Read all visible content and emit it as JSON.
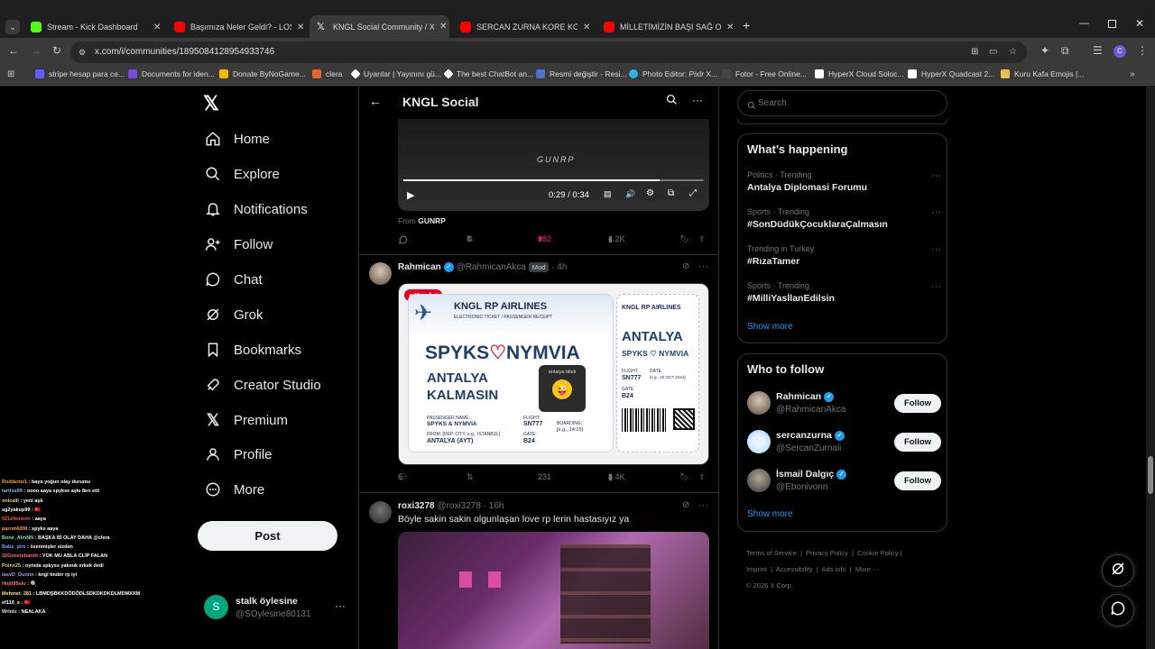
{
  "browser": {
    "tabs": [
      {
        "title": "Stream - Kick Dashboard",
        "color": "#53fc18"
      },
      {
        "title": "Başımıza Neler Geldi? - LOS AN",
        "color": "#ff0000"
      },
      {
        "title": "KNGL Social Community / X",
        "color": "#ffffff"
      },
      {
        "title": "SERCAN ZURNA KORE KOMİK A",
        "color": "#ff0000"
      },
      {
        "title": "MİLLETİMİZİN BAŞI SAĞ OLSUN",
        "color": "#ff0000"
      }
    ],
    "url": "x.com/i/communities/1895084128954933746",
    "bookmarks": [
      "stripe hesap para ce...",
      "Documents for iden...",
      "Donate ByNoGame...",
      "clera",
      "Uyarılar | Yayınını gü...",
      "The best ChatBot an...",
      "Resmi değiştir - Resi...",
      "Photo Editor: Pixlr X...",
      "Fotor - Free Online...",
      "HyperX Cloud Soloc...",
      "HyperX Quadcast 2...",
      "Kuru Kafa Emojis |..."
    ]
  },
  "nav": {
    "items": [
      "Home",
      "Explore",
      "Notifications",
      "Follow",
      "Chat",
      "Grok",
      "Bookmarks",
      "Creator Studio",
      "Premium",
      "Profile",
      "More"
    ],
    "post_label": "Post",
    "account": {
      "name": "stalk öylesine",
      "handle": "@SOylesine80131",
      "initial": "S"
    }
  },
  "header": {
    "title": "KNGL Social"
  },
  "video": {
    "time": "0:29 / 0:34",
    "brand": "GUNRP",
    "from_label": "From",
    "from_name": "GUNRP",
    "progress": 0.853
  },
  "post1_actions": {
    "replies": "",
    "reposts": "8",
    "likes": "282",
    "views": "4.2K"
  },
  "post2": {
    "name": "Rahmican",
    "handle": "@RahmicanAkca",
    "badge": "Mod",
    "time": "4h",
    "save_label": "Kaydet",
    "replies": "6",
    "reposts": "",
    "likes": "231",
    "views": "8.4K",
    "ticket": {
      "airline": "KNGL RP AIRLINES",
      "subtitle": "ELECTRONIC TICKET / PASSENGER RECEIPT",
      "name_left": "SPYKS",
      "name_right": "NYMVIA",
      "line1": "ANTALYA",
      "line2": "KALMASIN",
      "sticker": "antalya bileti",
      "passenger_label": "PASSENGER NAME:",
      "passenger": "SPYKS & NYMVIA",
      "from_label": "FROM: [DEP. CITY, e.g., ISTANBUL]",
      "from": "ANTALYA (AYT)",
      "flight_label": "FLIGHT:",
      "flight": "SN777",
      "gate_label": "GATE:",
      "gate": "B24",
      "boarding_label": "BOARDING:",
      "boarding": "[e.g., 14:15]",
      "stub_airline": "KNGL RP AIRLINES",
      "stub_dest": "ANTALYA",
      "stub_names": "SPYKS ♡ NYMVIA",
      "stub_flight_label": "FLIGHT",
      "stub_flight": "SN777",
      "stub_date_label": "DATE",
      "stub_date": "[e.g., 20 OCT 2024]",
      "stub_gate_label": "GATE",
      "stub_gate": "B24"
    }
  },
  "post3": {
    "name": "roxi3278",
    "handle": "@roxi3278",
    "time": "16h",
    "text": "Böyle sakin sakin olgunlaşan love rp lerin hastasıyız ya"
  },
  "search": {
    "placeholder": "Search"
  },
  "happening": {
    "title": "What’s happening",
    "trends": [
      {
        "meta": "Politics · Trending",
        "name": "Antalya Diplomasi Forumu"
      },
      {
        "meta": "Sports · Trending",
        "name": "#SonDüdükÇocuklaraÇalmasın"
      },
      {
        "meta": "Trending in Turkey",
        "name": "#RızaTamer"
      },
      {
        "meta": "Sports · Trending",
        "name": "#MilliYasİlanEdilsin"
      }
    ],
    "show_more": "Show more"
  },
  "who_to_follow": {
    "title": "Who to follow",
    "users": [
      {
        "name": "Rahmican",
        "handle": "@RahmicanAkca"
      },
      {
        "name": "sercanzurna",
        "handle": "@SercanZurnali"
      },
      {
        "name": "İsmail Dalgıç",
        "handle": "@Ebonivonn"
      }
    ],
    "follow_label": "Follow",
    "show_more": "Show more"
  },
  "footer": {
    "links": [
      "Terms of Service",
      "Privacy Policy",
      "Cookie Policy",
      "Imprint",
      "Accessibility",
      "Ads info",
      "More ···"
    ],
    "copyright": "© 2026 X Corp."
  },
  "stream_chat": [
    {
      "user": "Roddentz1",
      "msg": "baya yoğun olay durumu",
      "color": "#f5a623"
    },
    {
      "user": "tarttss99",
      "msg": "oooo aaya spykse aşkı 8en etti",
      "color": "#8ab4f8"
    },
    {
      "user": "onicalli",
      "msg": "yeni aşk",
      "color": "#f5d76e"
    },
    {
      "user": "sg2yakup99",
      "msg": "🇹🇷",
      "color": "#ffffff"
    },
    {
      "user": "021efemenn",
      "msg": "aaya",
      "color": "#ff5555"
    },
    {
      "user": "parrot4208",
      "msg": "spyks aaya",
      "color": "#ff9f43"
    },
    {
      "user": "Bone_AlmNN",
      "msg": "BAŞKA Bİ OLAY DAHA @clera",
      "color": "#7bed9f"
    },
    {
      "user": "Baba_pire",
      "msg": "özenmişler sizden",
      "color": "#70a1ff"
    },
    {
      "user": "32Gimetebanttt",
      "msg": "YOK MU ABLA CLİP FALAN",
      "color": "#ff6b81"
    },
    {
      "user": "Poinx25",
      "msg": "oynıda spkyss yakınık erkek dedi",
      "color": "#eccc68"
    },
    {
      "user": "tasvD_Dunnn",
      "msg": "kngl tinder rp iyi",
      "color": "#a29bfe"
    },
    {
      "user": "Hnjtt95slu",
      "msg": "🍭",
      "color": "#ff7979"
    },
    {
      "user": "Mehmet_281",
      "msg": "LBMDŞBKKDÖDÖDLSDKDKDKDLMDMXXM",
      "color": "#f6e58d"
    },
    {
      "user": "ef110_s",
      "msg": "🇹🇷",
      "color": "#ffffff"
    },
    {
      "user": "Wrlntz",
      "msg": "NEALAKA",
      "color": "#c7ecee"
    }
  ]
}
